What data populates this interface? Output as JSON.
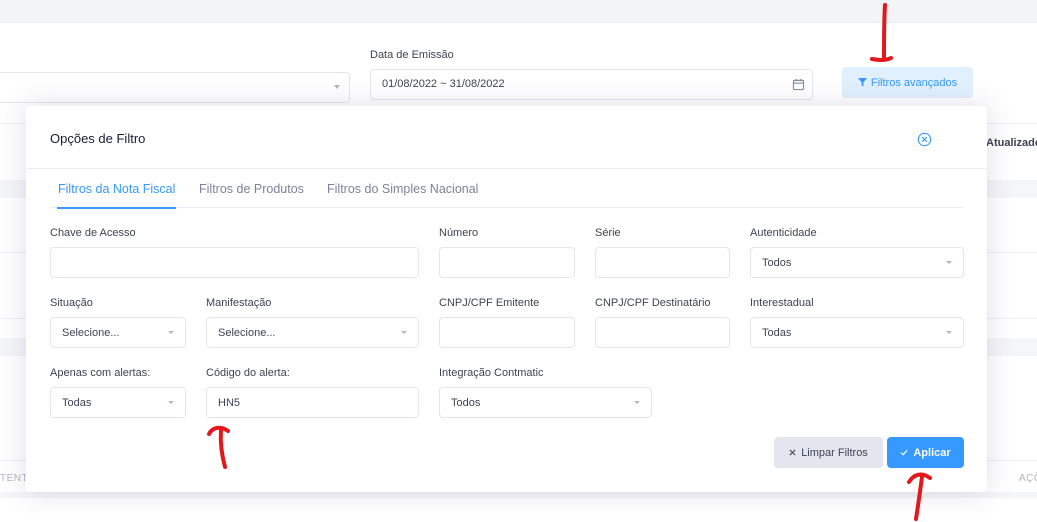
{
  "background": {
    "date_label": "Data de Emissão",
    "date_value": "01/08/2022 ~ 31/08/2022",
    "advanced_filters_label": "Filtros avançados",
    "column_atualizado": "Atualizado",
    "column_tente": "TENTE",
    "column_acoes": "AÇÕ"
  },
  "modal": {
    "title": "Opções de Filtro",
    "tabs": [
      {
        "label": "Filtros da Nota Fiscal"
      },
      {
        "label": "Filtros de Produtos"
      },
      {
        "label": "Filtros do Simples Nacional"
      }
    ],
    "fields": {
      "chave_acesso": {
        "label": "Chave de Acesso",
        "value": ""
      },
      "numero": {
        "label": "Número",
        "value": ""
      },
      "serie": {
        "label": "Série",
        "value": ""
      },
      "autenticidade": {
        "label": "Autenticidade",
        "value": "Todos"
      },
      "situacao": {
        "label": "Situação",
        "value": "Selecione..."
      },
      "manifestacao": {
        "label": "Manifestação",
        "value": "Selecione..."
      },
      "cnpj_emitente": {
        "label": "CNPJ/CPF Emitente",
        "value": ""
      },
      "cnpj_destinatario": {
        "label": "CNPJ/CPF Destinatário",
        "value": ""
      },
      "interestadual": {
        "label": "Interestadual",
        "value": "Todas"
      },
      "apenas_alertas": {
        "label": "Apenas com alertas:",
        "value": "Todas"
      },
      "codigo_alerta": {
        "label": "Código do alerta:",
        "value": "HN5"
      },
      "integracao_contmatic": {
        "label": "Integração Contmatic",
        "value": "Todos"
      }
    },
    "buttons": {
      "clear_label": "Limpar Filtros",
      "apply_label": "Aplicar"
    }
  },
  "colors": {
    "primary": "#3699ff",
    "primary_light": "#e1f0ff",
    "annotation": "#e3171c"
  }
}
